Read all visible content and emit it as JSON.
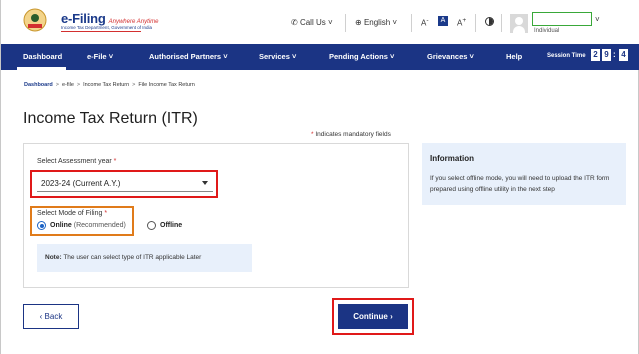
{
  "header": {
    "brand_name": "e-Filing",
    "brand_tagline": "Anywhere Anytime",
    "brand_dept": "Income Tax Department, Government of India",
    "call_us": "Call Us",
    "language": "English",
    "font_small": "A",
    "font_normal": "A",
    "font_large": "A",
    "user_role": "Individual"
  },
  "nav": {
    "items": [
      "Dashboard",
      "e-File",
      "Authorised Partners",
      "Services",
      "Pending Actions",
      "Grievances",
      "Help"
    ],
    "session_label": "Session Time",
    "session_digits": [
      "2",
      "9",
      "4"
    ],
    "session_colon": ":",
    "dropdown_caret": "˅"
  },
  "breadcrumb": [
    "Dashboard",
    "e-file",
    "Income Tax Return",
    "File Income Tax Return"
  ],
  "breadcrumb_sep": ">",
  "page": {
    "title": "Income Tax Return (ITR)",
    "mandatory_note": "Indicates mandatory fields",
    "asterisk": "*"
  },
  "form": {
    "assessment_year_label": "Select Assessment year",
    "assessment_year_value": "2023-24 (Current A.Y.)",
    "mode_label": "Select Mode of Filing",
    "online_label": "Online",
    "online_sub": "(Recommended)",
    "offline_label": "Offline",
    "note_label": "Note:",
    "note_text": "The user can select type of ITR applicable Later"
  },
  "info": {
    "title": "Information",
    "text": "If you select offline mode, you will need to upload the ITR form prepared using offline utility in the next step"
  },
  "buttons": {
    "back": "‹  Back",
    "continue": "Continue  ›"
  },
  "colors": {
    "nav_bg": "#1b3484",
    "highlight_red": "#e01919",
    "highlight_orange": "#e07b1a",
    "info_bg": "#e8f0fb"
  }
}
